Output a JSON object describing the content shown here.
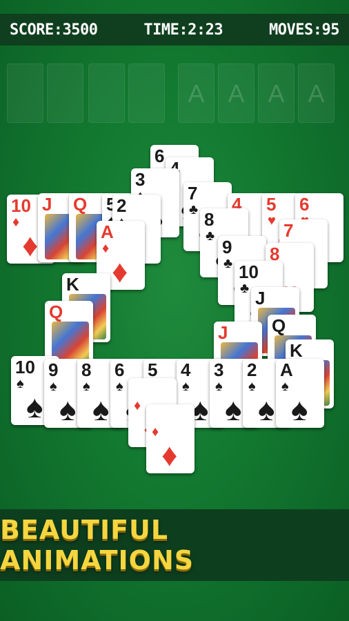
{
  "hud": {
    "score": "SCORE:3500",
    "time": "TIME:2:23",
    "moves": "MOVES:95"
  },
  "foundations": {
    "empty_count": 4,
    "ace_slots": [
      "A",
      "A",
      "A",
      "A"
    ]
  },
  "cards": [
    {
      "rank": "10",
      "suit": "♦",
      "color": "red"
    },
    {
      "rank": "J",
      "suit": "♦",
      "color": "red"
    },
    {
      "rank": "Q",
      "suit": "♦",
      "color": "red"
    },
    {
      "rank": "5",
      "suit": "♠",
      "color": "black"
    },
    {
      "rank": "6",
      "suit": "♣",
      "color": "black"
    },
    {
      "rank": "4",
      "suit": "♠",
      "color": "black"
    },
    {
      "rank": "3",
      "suit": "♠",
      "color": "black"
    },
    {
      "rank": "2",
      "suit": "♠",
      "color": "black"
    },
    {
      "rank": "A",
      "suit": "♦",
      "color": "red"
    },
    {
      "rank": "7",
      "suit": "♣",
      "color": "black"
    },
    {
      "rank": "4",
      "suit": "♥",
      "color": "red"
    },
    {
      "rank": "5",
      "suit": "♥",
      "color": "red"
    },
    {
      "rank": "6",
      "suit": "♥",
      "color": "red"
    },
    {
      "rank": "8",
      "suit": "♣",
      "color": "black"
    },
    {
      "rank": "7",
      "suit": "♥",
      "color": "red"
    },
    {
      "rank": "9",
      "suit": "♣",
      "color": "black"
    },
    {
      "rank": "8",
      "suit": "♥",
      "color": "red"
    },
    {
      "rank": "10",
      "suit": "♣",
      "color": "black"
    },
    {
      "rank": "K",
      "suit": "♠",
      "color": "black"
    },
    {
      "rank": "Q",
      "suit": "♦",
      "color": "red"
    },
    {
      "rank": "J",
      "suit": "♣",
      "color": "black"
    },
    {
      "rank": "Q",
      "suit": "♣",
      "color": "black"
    },
    {
      "rank": "J",
      "suit": "♦",
      "color": "red"
    },
    {
      "rank": "K",
      "suit": "♣",
      "color": "black"
    },
    {
      "rank": "10",
      "suit": "♠",
      "color": "black"
    },
    {
      "rank": "9",
      "suit": "♠",
      "color": "black"
    },
    {
      "rank": "8",
      "suit": "♠",
      "color": "black"
    },
    {
      "rank": "6",
      "suit": "♠",
      "color": "black"
    },
    {
      "rank": "5",
      "suit": "♠",
      "color": "black"
    },
    {
      "rank": "4",
      "suit": "♠",
      "color": "black"
    },
    {
      "rank": "3",
      "suit": "♠",
      "color": "black"
    },
    {
      "rank": "2",
      "suit": "♠",
      "color": "black"
    },
    {
      "rank": "A",
      "suit": "♠",
      "color": "black"
    },
    {
      "rank": "",
      "suit": "♦",
      "color": "red"
    },
    {
      "rank": "",
      "suit": "♦",
      "color": "red"
    }
  ],
  "banner": {
    "text": "BEAUTIFUL ANIMATIONS"
  },
  "colors": {
    "table_green": "#137a31",
    "hud_bar": "#0f3f1f",
    "banner_text": "#f5d640",
    "red_suit": "#e53a2f",
    "black_suit": "#1a1a1a"
  }
}
